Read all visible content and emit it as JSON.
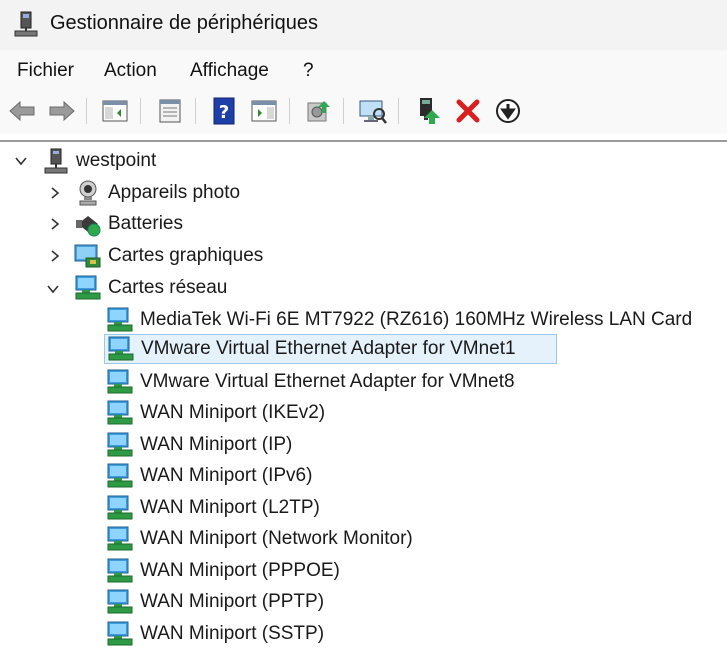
{
  "window": {
    "title": "Gestionnaire de périphériques"
  },
  "menu": {
    "items": [
      "Fichier",
      "Action",
      "Affichage",
      "?"
    ]
  },
  "toolbar": {
    "buttons": [
      "back-arrow-icon",
      "forward-arrow-icon",
      "show-hide-console-tree-icon",
      "properties-icon",
      "help-icon",
      "action-pane-icon",
      "update-driver-icon",
      "scan-hardware-icon",
      "enable-device-icon",
      "uninstall-device-icon",
      "disable-device-icon"
    ]
  },
  "tree": {
    "root": {
      "label": "westpoint",
      "expanded": true
    },
    "categories": [
      {
        "label": "Appareils photo",
        "expanded": false,
        "icon": "camera-icon"
      },
      {
        "label": "Batteries",
        "expanded": false,
        "icon": "battery-icon"
      },
      {
        "label": "Cartes graphiques",
        "expanded": false,
        "icon": "display-adapter-icon"
      },
      {
        "label": "Cartes réseau",
        "expanded": true,
        "icon": "network-adapter-icon"
      }
    ],
    "network_devices": [
      "MediaTek Wi-Fi 6E MT7922 (RZ616) 160MHz Wireless LAN Card",
      "VMware Virtual Ethernet Adapter for VMnet1",
      "VMware Virtual Ethernet Adapter for VMnet8",
      "WAN Miniport (IKEv2)",
      "WAN Miniport (IP)",
      "WAN Miniport (IPv6)",
      "WAN Miniport (L2TP)",
      "WAN Miniport (Network Monitor)",
      "WAN Miniport (PPPOE)",
      "WAN Miniport (PPTP)",
      "WAN Miniport (SSTP)"
    ],
    "selected": "VMware Virtual Ethernet Adapter for VMnet1"
  },
  "colors": {
    "selection_bg": "#e5f1fb",
    "selection_border": "#99c9ef",
    "titlebar_bg": "#f3f3f3",
    "menubar_bg": "#f9f9f9"
  }
}
